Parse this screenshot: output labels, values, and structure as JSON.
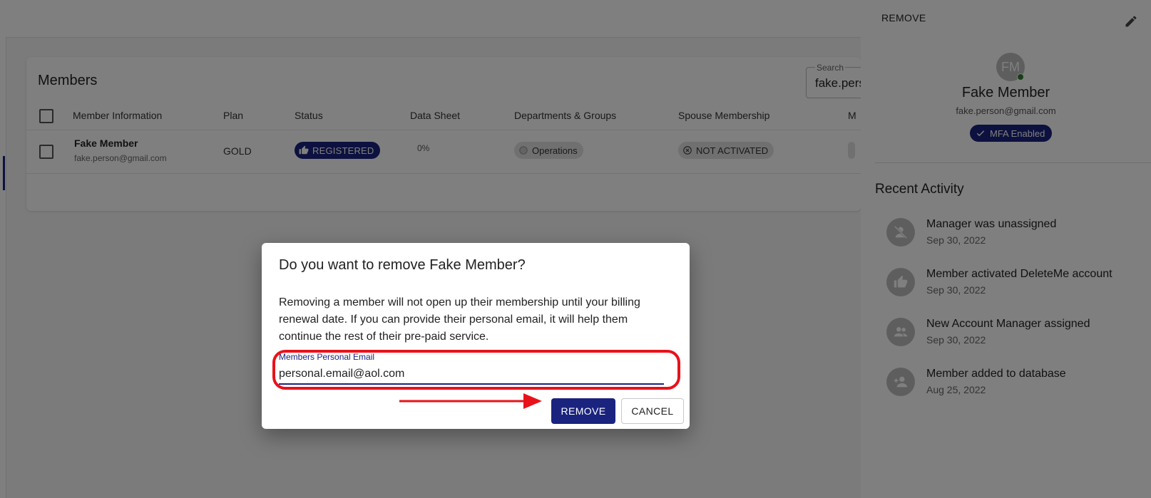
{
  "card": {
    "title": "Members",
    "search": {
      "label": "Search",
      "value": "fake.pers"
    },
    "columns": [
      "Member Information",
      "Plan",
      "Status",
      "Data Sheet",
      "Departments & Groups",
      "Spouse Membership",
      "M"
    ],
    "row": {
      "name": "Fake Member",
      "email": "fake.person@gmail.com",
      "plan": "GOLD",
      "status": "REGISTERED",
      "data_sheet": "0%",
      "department": "Operations",
      "spouse": "NOT ACTIVATED"
    }
  },
  "drawer": {
    "remove_label": "REMOVE",
    "avatar_initials": "FM",
    "name": "Fake Member",
    "email": "fake.person@gmail.com",
    "mfa_label": "MFA Enabled",
    "recent_title": "Recent Activity",
    "activities": [
      {
        "text": "Manager was unassigned",
        "date": "Sep 30, 2022",
        "icon": "person-off-icon"
      },
      {
        "text": "Member activated DeleteMe account",
        "date": "Sep 30, 2022",
        "icon": "thumb-up-icon"
      },
      {
        "text": "New Account Manager assigned",
        "date": "Sep 30, 2022",
        "icon": "people-icon"
      },
      {
        "text": "Member added to database",
        "date": "Aug 25, 2022",
        "icon": "person-add-icon"
      }
    ]
  },
  "dialog": {
    "title": "Do you want to remove Fake Member?",
    "body": "Removing a member will not open up their membership until your billing renewal date. If you can provide their personal email, it will help them continue the rest of their pre-paid service.",
    "field_label": "Members Personal Email",
    "field_value": "personal.email@aol.com",
    "remove_button": "REMOVE",
    "cancel_button": "CANCEL"
  },
  "colors": {
    "primary": "#1a237e",
    "annotation": "#e8121a",
    "online": "#2e7d32"
  }
}
